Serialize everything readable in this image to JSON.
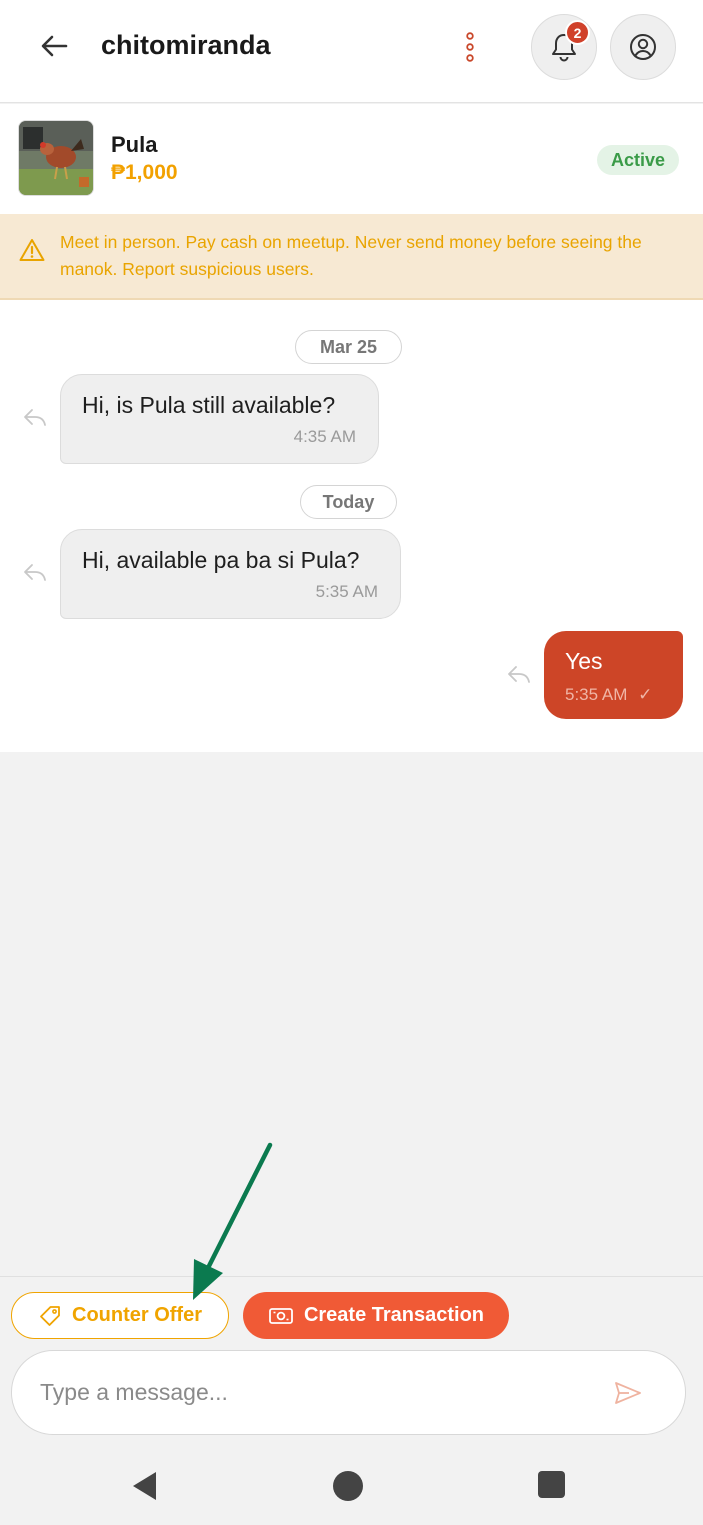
{
  "header": {
    "title": "chitomiranda",
    "notification_count": "2"
  },
  "listing": {
    "name": "Pula",
    "price": "₱1,000",
    "status": "Active"
  },
  "warning": {
    "text": "Meet in person. Pay cash on meetup. Never send money before seeing the manok. Report suspicious users."
  },
  "chat": {
    "dates": [
      "Mar 25",
      "Today"
    ],
    "messages": [
      {
        "direction": "incoming",
        "text": "Hi, is Pula still available?",
        "time": "4:35 AM"
      },
      {
        "direction": "incoming",
        "text": "Hi, available pa ba si Pula?",
        "time": "5:35 AM"
      },
      {
        "direction": "outgoing",
        "text": "Yes",
        "time": "5:35 AM",
        "read_mark": "✓"
      }
    ]
  },
  "actions": {
    "counter_offer": "Counter Offer",
    "create_transaction": "Create Transaction"
  },
  "composer": {
    "placeholder": "Type a message..."
  },
  "colors": {
    "accent_orange": "#f05a36",
    "gold": "#f0a400",
    "outgoing_bubble": "#cd4527",
    "active_green": "#3a9b48",
    "annotation_arrow": "#0b7a4f"
  },
  "icons": {
    "back": "arrow-left-icon",
    "menu": "kebab-menu-icon",
    "bell": "bell-icon",
    "profile": "user-circle-icon",
    "warning": "warning-triangle-icon",
    "reply": "reply-icon",
    "tag": "tag-icon",
    "money": "banknote-icon",
    "send": "send-icon"
  }
}
